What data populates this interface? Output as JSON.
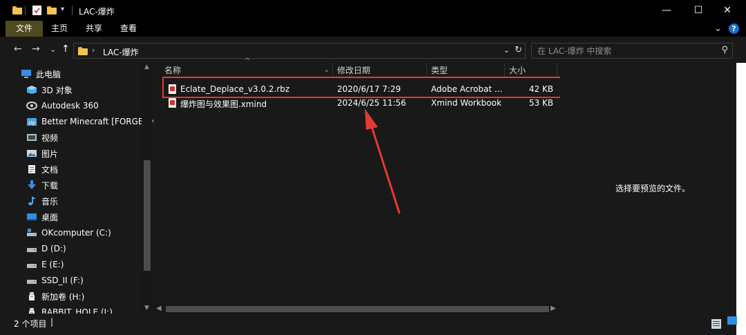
{
  "window": {
    "title": "LAC-爆炸",
    "controls": {
      "minimize": "—",
      "maximize": "☐",
      "close": "✕"
    }
  },
  "ribbon": {
    "tabs": [
      "文件",
      "主页",
      "共享",
      "查看"
    ],
    "chevron": "⌄",
    "help": "?"
  },
  "address": {
    "path": "LAC-爆炸",
    "back": "←",
    "forward": "→",
    "recent": "⌄",
    "up": "↑",
    "dropdown": "⌄",
    "refresh": "↻"
  },
  "search": {
    "placeholder": "在 LAC-爆炸 中搜索",
    "icon": "⚲"
  },
  "nav": {
    "items": [
      {
        "label": "此电脑",
        "icon": "pc-icon"
      },
      {
        "label": "3D 对象",
        "icon": "3d-objects-icon"
      },
      {
        "label": "Autodesk 360",
        "icon": "autodesk-icon"
      },
      {
        "label": "Better Minecraft [FORGE] v",
        "icon": "minecraft-folder-icon"
      },
      {
        "label": "视频",
        "icon": "video-icon"
      },
      {
        "label": "图片",
        "icon": "pictures-icon"
      },
      {
        "label": "文档",
        "icon": "documents-icon"
      },
      {
        "label": "下载",
        "icon": "download-icon"
      },
      {
        "label": "音乐",
        "icon": "music-icon"
      },
      {
        "label": "桌面",
        "icon": "desktop-icon"
      },
      {
        "label": "OKcomputer (C:)",
        "icon": "system-drive-icon"
      },
      {
        "label": "D (D:)",
        "icon": "drive-icon"
      },
      {
        "label": "E (E:)",
        "icon": "drive-icon"
      },
      {
        "label": "SSD_II (F:)",
        "icon": "drive-icon"
      },
      {
        "label": "新加卷 (H:)",
        "icon": "usb-drive-icon"
      },
      {
        "label": "RABBIT_HOLE (I:)",
        "icon": "usb-drive-icon"
      }
    ]
  },
  "columns": {
    "name": "名称",
    "modified": "修改日期",
    "type": "类型",
    "size": "大小"
  },
  "files": [
    {
      "name": "Eclate_Deplace_v3.0.2.rbz",
      "modified": "2020/6/17 7:29",
      "type": "Adobe Acrobat ...",
      "size": "42 KB"
    },
    {
      "name": "爆炸图与效果图.xmind",
      "modified": "2024/6/25 11:56",
      "type": "Xmind Workbook",
      "size": "53 KB"
    }
  ],
  "preview": {
    "message": "选择要预览的文件。"
  },
  "status": {
    "count": "2 个项目"
  },
  "colors": {
    "highlight": "#e53935",
    "arrow": "#e53935",
    "file_tab": "#4f4a20",
    "folder": "#f4c44f"
  }
}
